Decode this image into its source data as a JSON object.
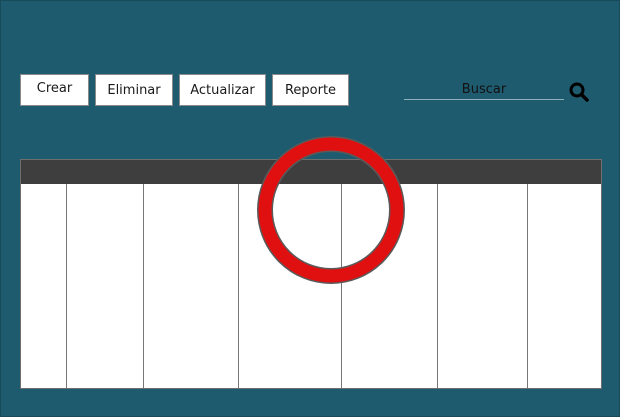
{
  "toolbar": {
    "crear_label": "Crear",
    "eliminar_label": "Eliminar",
    "actualizar_label": "Actualizar",
    "reporte_label": "Reporte"
  },
  "search": {
    "label": "Buscar",
    "icon": "search-icon"
  },
  "colors": {
    "background": "#1f5b6f",
    "grid_header": "#3e3e3e",
    "ring": "#e01010"
  },
  "overlay": {
    "icon": "red-ring-icon"
  }
}
